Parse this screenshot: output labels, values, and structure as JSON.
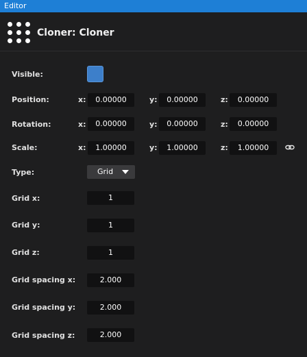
{
  "window": {
    "title": "Editor"
  },
  "header": {
    "title": "Cloner: Cloner",
    "icon": "grid-dots-icon"
  },
  "properties": {
    "visible": {
      "label": "Visible:",
      "checked": true,
      "color": "#3d7fca"
    },
    "position": {
      "label": "Position:",
      "x_label": "x:",
      "y_label": "y:",
      "z_label": "z:",
      "x": "0.00000",
      "y": "0.00000",
      "z": "0.00000"
    },
    "rotation": {
      "label": "Rotation:",
      "x_label": "x:",
      "y_label": "y:",
      "z_label": "z:",
      "x": "0.00000",
      "y": "0.00000",
      "z": "0.00000"
    },
    "scale": {
      "label": "Scale:",
      "x_label": "x:",
      "y_label": "y:",
      "z_label": "z:",
      "x": "1.00000",
      "y": "1.00000",
      "z": "1.00000",
      "link_icon": "link-icon"
    },
    "type": {
      "label": "Type:",
      "value": "Grid"
    },
    "grid_x": {
      "label": "Grid x:",
      "value": "1"
    },
    "grid_y": {
      "label": "Grid y:",
      "value": "1"
    },
    "grid_z": {
      "label": "Grid z:",
      "value": "1"
    },
    "grid_spacing_x": {
      "label": "Grid spacing x:",
      "value": "2.000"
    },
    "grid_spacing_y": {
      "label": "Grid spacing y:",
      "value": "2.000"
    },
    "grid_spacing_z": {
      "label": "Grid spacing z:",
      "value": "2.000"
    }
  }
}
